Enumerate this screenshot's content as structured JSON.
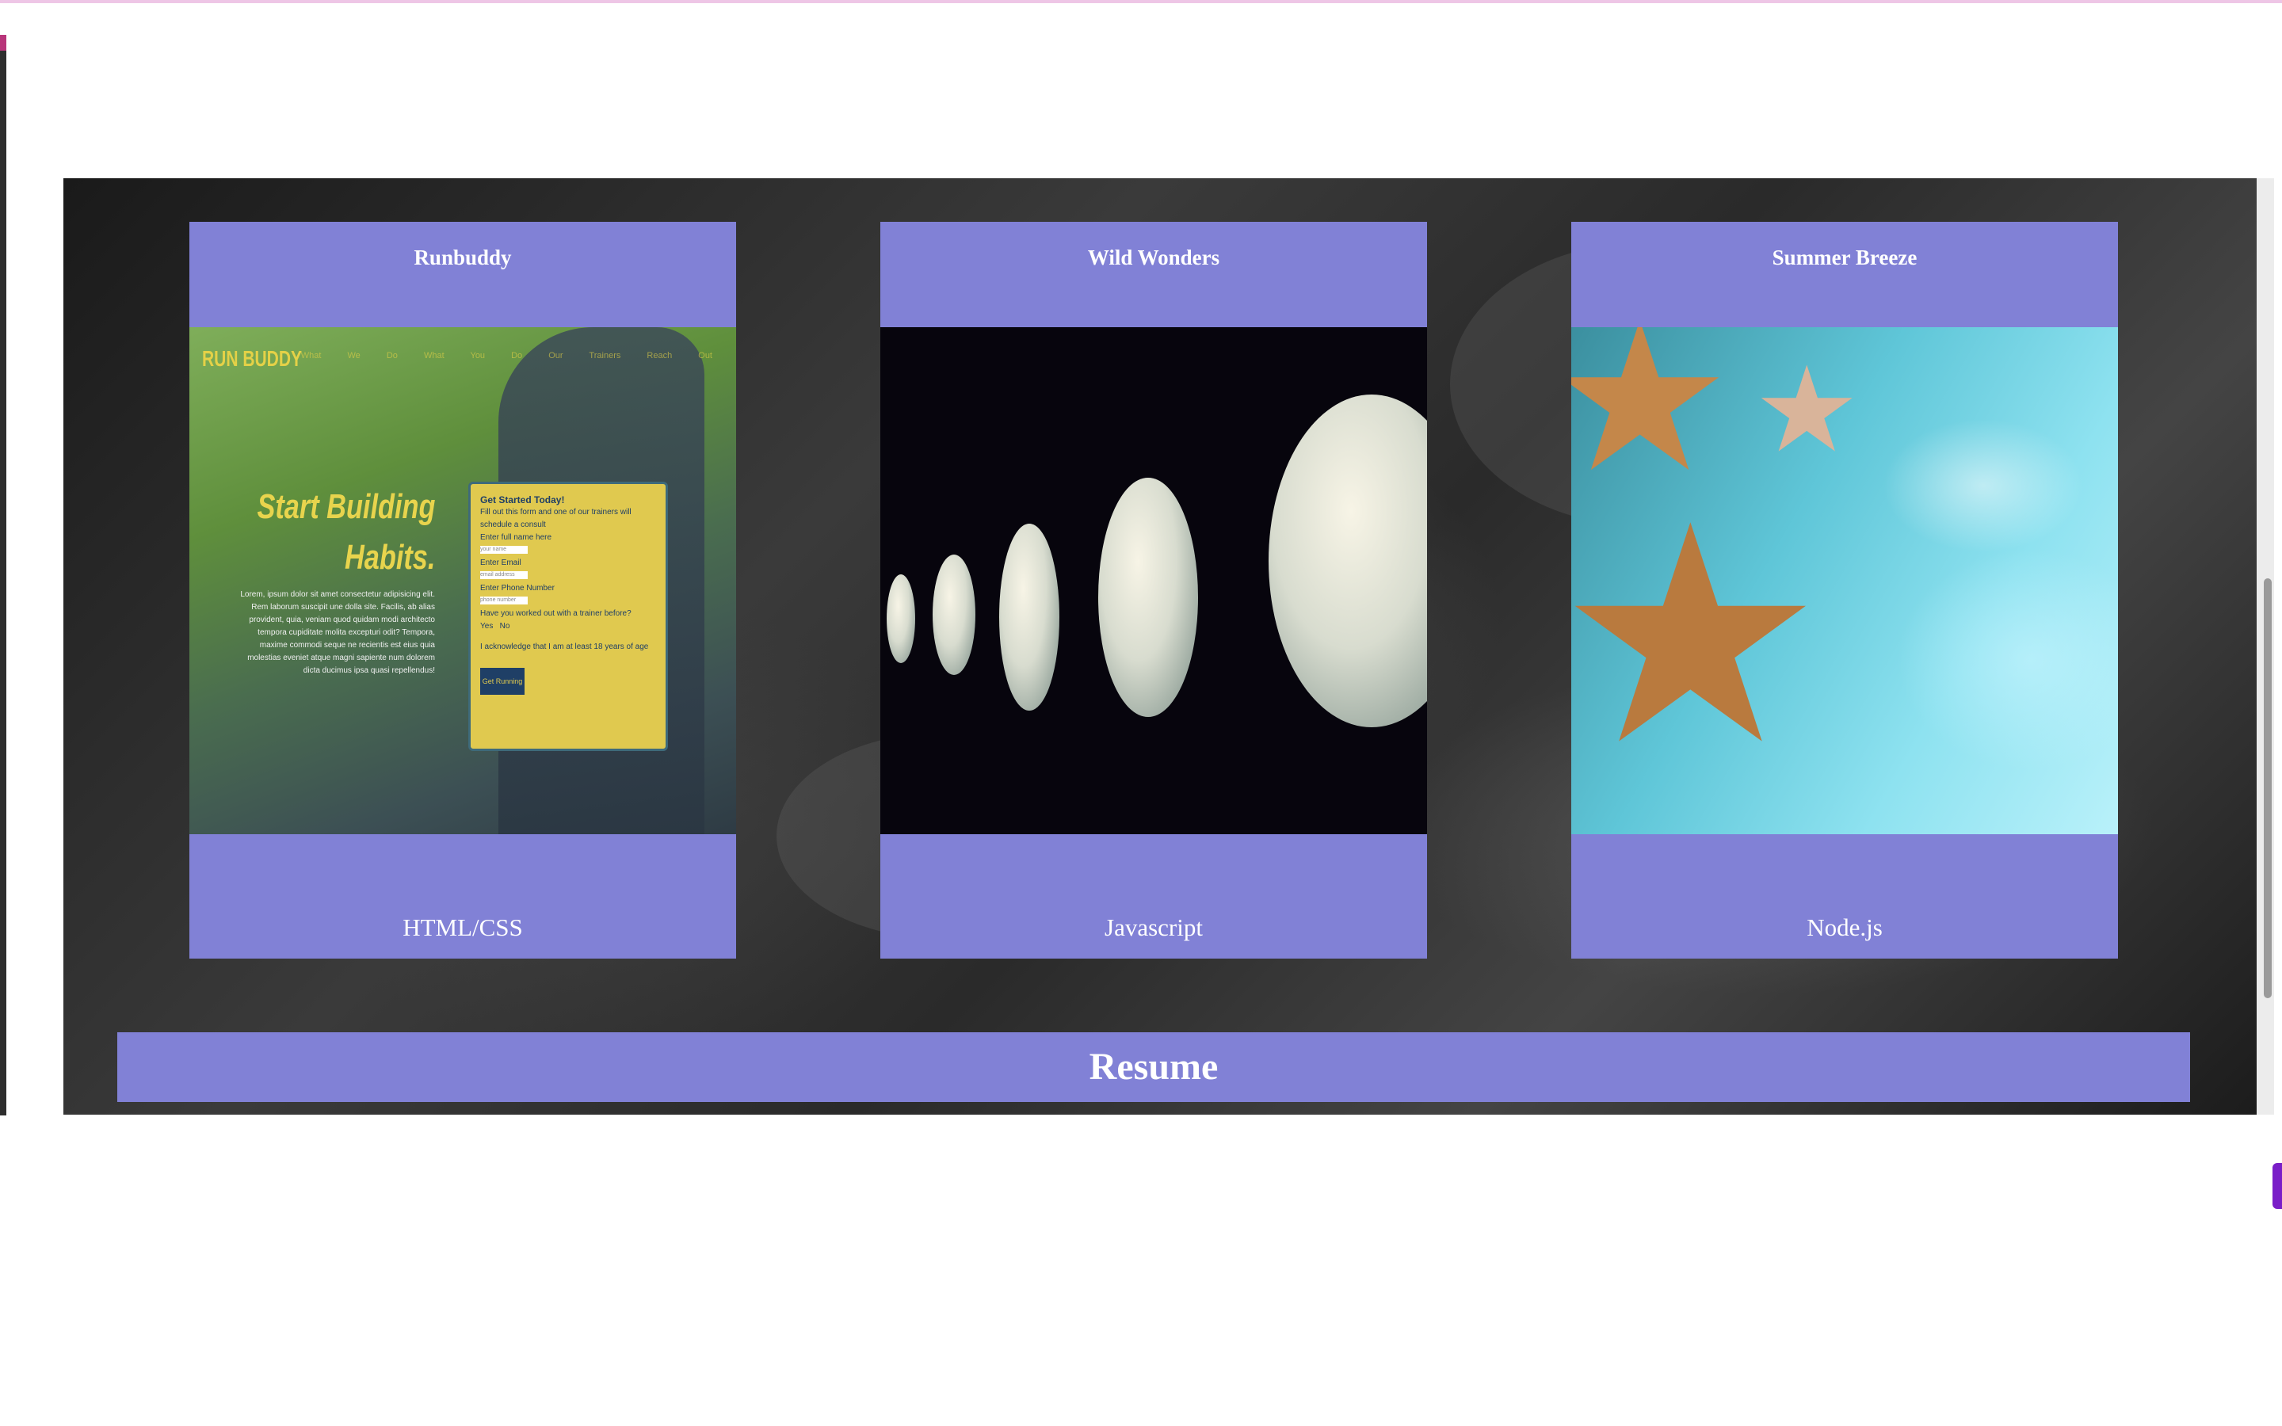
{
  "projects": [
    {
      "title": "Runbuddy",
      "tech": "HTML/CSS"
    },
    {
      "title": "Wild Wonders",
      "tech": "Javascript"
    },
    {
      "title": "Summer Breeze",
      "tech": "Node.js"
    }
  ],
  "runbuddy_thumb": {
    "logo": "RUN BUDDY",
    "nav": "What We Do What You Do Our Trainers Reach Out",
    "headline_1": "Start Building",
    "headline_2": "Habits.",
    "lorem": "Lorem, ipsum dolor sit amet consectetur adipisicing elit. Rem laborum suscipit une dolla site. Facilis, ab alias provident, quia, veniam quod quidam modi architecto tempora cupiditate molita excepturi odit? Tempora, maxime commodi seque ne recientis est eius quia molestias eveniet atque magni sapiente num dolorem dicta ducimus ipsa quasi repellendus!",
    "form_title": "Get Started Today!",
    "form_sub": "Fill out this form and one of our trainers will schedule a consult",
    "form_name_label": "Enter full name here",
    "form_name_placeholder": "your name",
    "form_email_label": "Enter Email",
    "form_email_placeholder": "email address",
    "form_phone_label": "Enter Phone Number",
    "form_phone_placeholder": "phone number",
    "form_question": "Have you worked out with a trainer before?",
    "form_yes": "Yes",
    "form_no": "No",
    "form_ack": "I acknowledge that I am at least 18 years of age",
    "form_button": "Get Running"
  },
  "resume": {
    "label": "Resume"
  },
  "colors": {
    "card_bg": "#8181d6",
    "section_bg": "#141414",
    "text": "#ffffff"
  }
}
